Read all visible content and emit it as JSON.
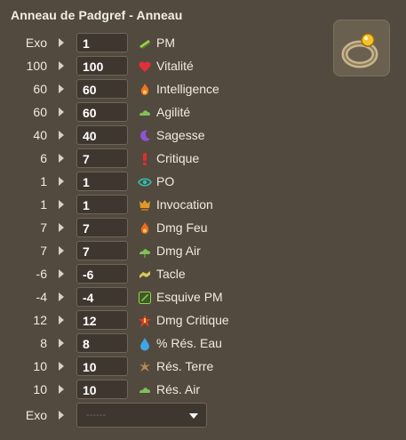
{
  "title": "Anneau de Padgref - Anneau",
  "rows": [
    {
      "base": "Exo",
      "value": "1",
      "stat": "PM",
      "icon": "pm-icon"
    },
    {
      "base": "100",
      "value": "100",
      "stat": "Vitalité",
      "icon": "heart-icon"
    },
    {
      "base": "60",
      "value": "60",
      "stat": "Intelligence",
      "icon": "fire-icon"
    },
    {
      "base": "60",
      "value": "60",
      "stat": "Agilité",
      "icon": "air-icon"
    },
    {
      "base": "40",
      "value": "40",
      "stat": "Sagesse",
      "icon": "moon-icon"
    },
    {
      "base": "6",
      "value": "7",
      "stat": "Critique",
      "icon": "exclamation-icon"
    },
    {
      "base": "1",
      "value": "1",
      "stat": "PO",
      "icon": "eye-icon"
    },
    {
      "base": "1",
      "value": "1",
      "stat": "Invocation",
      "icon": "summon-icon"
    },
    {
      "base": "7",
      "value": "7",
      "stat": "Dmg Feu",
      "icon": "fire-damage-icon"
    },
    {
      "base": "7",
      "value": "7",
      "stat": "Dmg Air",
      "icon": "air-damage-icon"
    },
    {
      "base": "-6",
      "value": "-6",
      "stat": "Tacle",
      "icon": "tackle-icon"
    },
    {
      "base": "-4",
      "value": "-4",
      "stat": "Esquive PM",
      "icon": "dodge-mp-icon"
    },
    {
      "base": "12",
      "value": "12",
      "stat": "Dmg Critique",
      "icon": "critical-damage-icon"
    },
    {
      "base": "8",
      "value": "8",
      "stat": "% Rés. Eau",
      "icon": "water-drop-icon"
    },
    {
      "base": "10",
      "value": "10",
      "stat": "Rés. Terre",
      "icon": "earth-resist-icon"
    },
    {
      "base": "10",
      "value": "10",
      "stat": "Rés. Air",
      "icon": "air-resist-icon"
    }
  ],
  "exo": {
    "label": "Exo",
    "placeholder": "------"
  }
}
